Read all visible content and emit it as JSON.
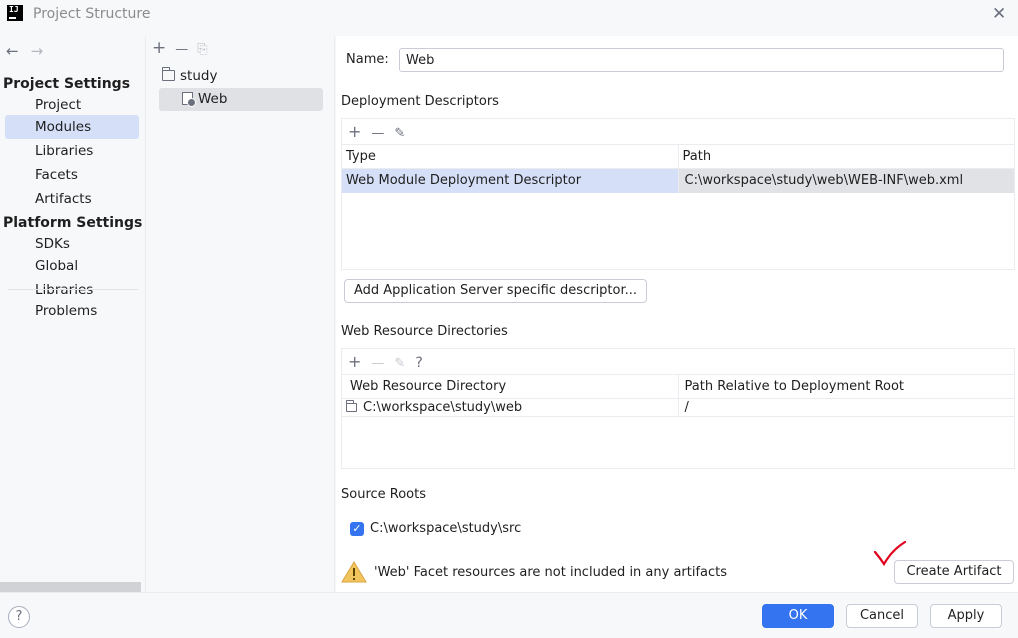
{
  "window": {
    "title": "Project Structure",
    "logo_text": "IJ"
  },
  "nav": {
    "back_icon": "←",
    "forward_icon": "→",
    "sections": [
      {
        "title": "Project Settings",
        "items": [
          "Project",
          "Modules",
          "Libraries",
          "Facets",
          "Artifacts"
        ]
      },
      {
        "title": "Platform Settings",
        "items": [
          "SDKs",
          "Global Libraries"
        ]
      }
    ],
    "problems": "Problems",
    "selected": "Modules"
  },
  "tree": {
    "add_icon": "+",
    "remove_icon": "—",
    "copy_icon": "⎘",
    "items": [
      {
        "label": "study",
        "icon": "folder-icon"
      },
      {
        "label": "Web",
        "icon": "web-module-icon",
        "selected": true
      }
    ]
  },
  "main": {
    "name_label": "Name:",
    "name_value": "Web",
    "deployment": {
      "title": "Deployment Descriptors",
      "columns": [
        "Type",
        "Path"
      ],
      "rows": [
        {
          "type": "Web Module Deployment Descriptor",
          "path": "C:\\workspace\\study\\web\\WEB-INF\\web.xml"
        }
      ],
      "add_server_button": "Add Application Server specific descriptor..."
    },
    "web_resources": {
      "title": "Web Resource Directories",
      "columns": [
        "Web Resource Directory",
        "Path Relative to Deployment Root"
      ],
      "rows": [
        {
          "dir": "C:\\workspace\\study\\web",
          "rel": "/"
        }
      ],
      "help_icon": "?"
    },
    "source_roots": {
      "title": "Source Roots",
      "items": [
        {
          "path": "C:\\workspace\\study\\src",
          "checked": true
        }
      ]
    },
    "warning": {
      "text": "'Web' Facet resources are not included in any artifacts",
      "button": "Create Artifact"
    }
  },
  "footer": {
    "help": "?",
    "ok": "OK",
    "cancel": "Cancel",
    "apply": "Apply"
  },
  "colors": {
    "accent": "#3574f0",
    "selection": "#d5e0f8",
    "warning": "#f2c55c",
    "annotation": "#e0001b"
  }
}
